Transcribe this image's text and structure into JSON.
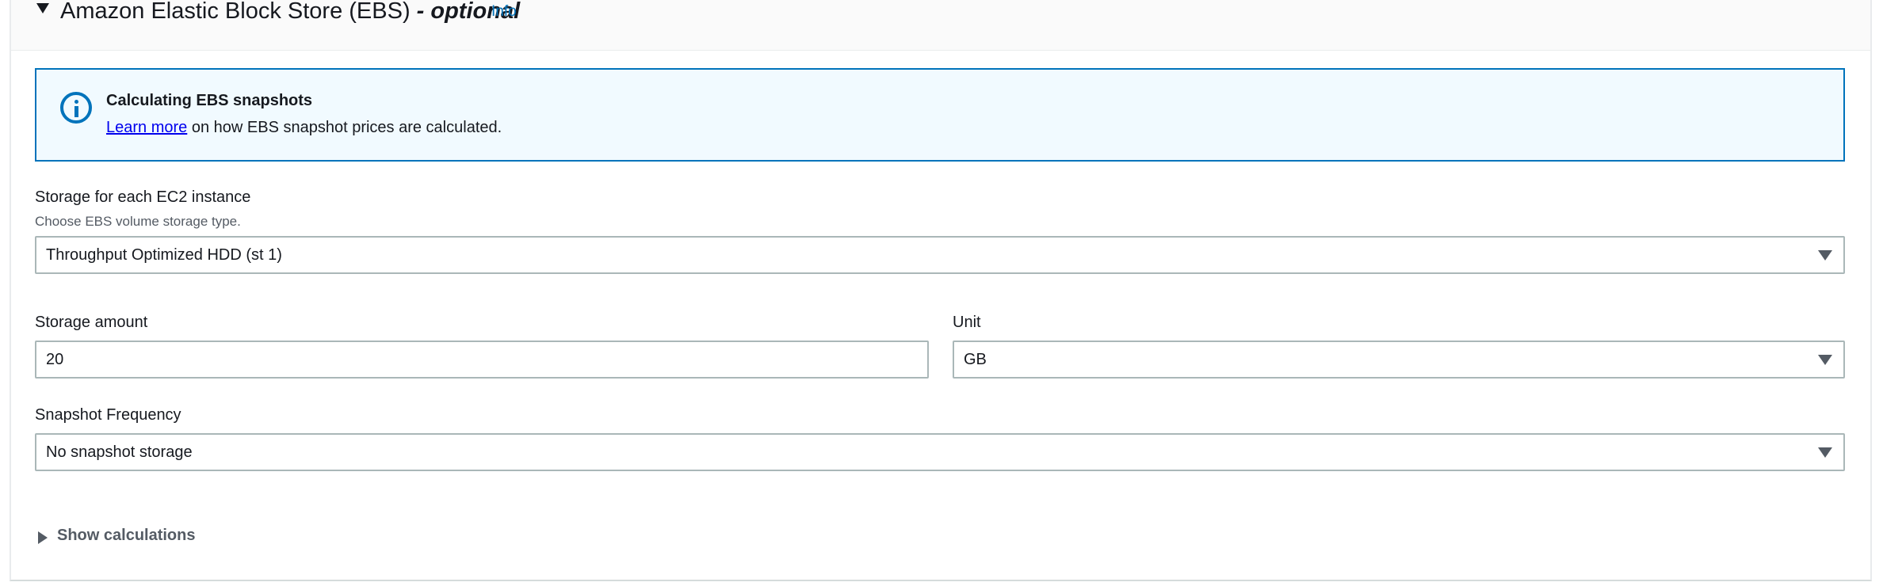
{
  "section": {
    "title": "Amazon Elastic Block Store (EBS)",
    "optional": " - optional",
    "info": "Info"
  },
  "alert": {
    "icon": "info-circle-icon",
    "title": "Calculating EBS snapshots",
    "link": "Learn more",
    "text": " on how EBS snapshot prices are calculated."
  },
  "storage_type": {
    "label": "Storage for each EC2 instance",
    "description": "Choose EBS volume storage type.",
    "value": "Throughput Optimized HDD (st 1)"
  },
  "storage_amount": {
    "label": "Storage amount",
    "value": "20"
  },
  "unit": {
    "label": "Unit",
    "value": "GB"
  },
  "snapshot": {
    "label": "Snapshot Frequency",
    "value": "No snapshot storage"
  },
  "show_calculations": "Show calculations",
  "colors": {
    "accent": "#0073bb",
    "alert_bg": "#f1faff",
    "border": "#aab7b8"
  }
}
